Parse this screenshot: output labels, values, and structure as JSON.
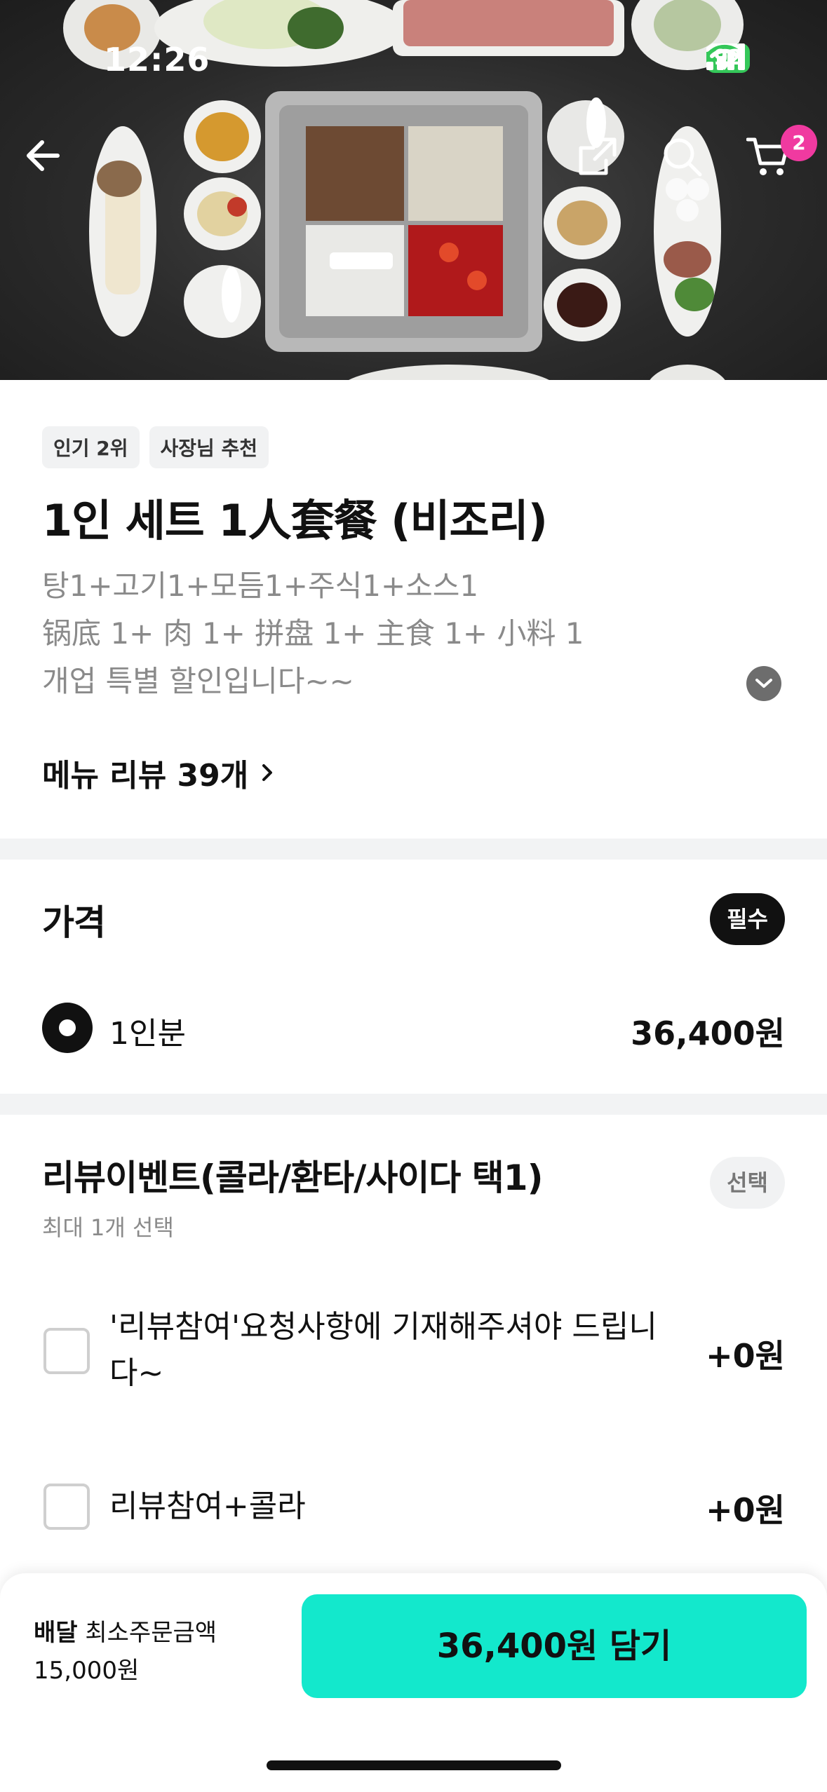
{
  "status_bar": {
    "time": "12:26",
    "battery": "92"
  },
  "header": {
    "cart_count": "2",
    "back_icon": "arrow-left-icon",
    "share_icon": "share-icon",
    "search_icon": "search-icon",
    "cart_icon": "cart-icon"
  },
  "item": {
    "tags": [
      "인기 2위",
      "사장님 추천"
    ],
    "title": "1인 세트 1人套餐 (비조리)",
    "description": [
      "탕1+고기1+모듬1+주식1+소스1",
      "锅底 1+ 肉 1+ 拼盘 1+ 主食 1+ 小料 1",
      "개업 특별 할인입니다~~"
    ],
    "reviews_link": "메뉴 리뷰 39개"
  },
  "price_section": {
    "title": "가격",
    "badge": "필수",
    "options": [
      {
        "label": "1인분",
        "price": "36,400원",
        "selected": true
      }
    ]
  },
  "event_section": {
    "title": "리뷰이벤트(콜라/환타/사이다 택1)",
    "badge": "선택",
    "note": "최대 1개 선택",
    "options": [
      {
        "label": "'리뷰참여'요청사항에 기재해주셔야 드립니다~",
        "price": "+0원",
        "checked": false
      },
      {
        "label": "리뷰참여+콜라",
        "price": "+0원",
        "checked": false
      }
    ]
  },
  "bottom_bar": {
    "delivery_label": "배달",
    "min_order_label": "최소주문금액",
    "min_order_value": "15,000원",
    "cta_label": "36,400원 담기"
  },
  "colors": {
    "accent": "#13e8cc",
    "badge_pink": "#f03aa0",
    "battery_green": "#34c759"
  }
}
